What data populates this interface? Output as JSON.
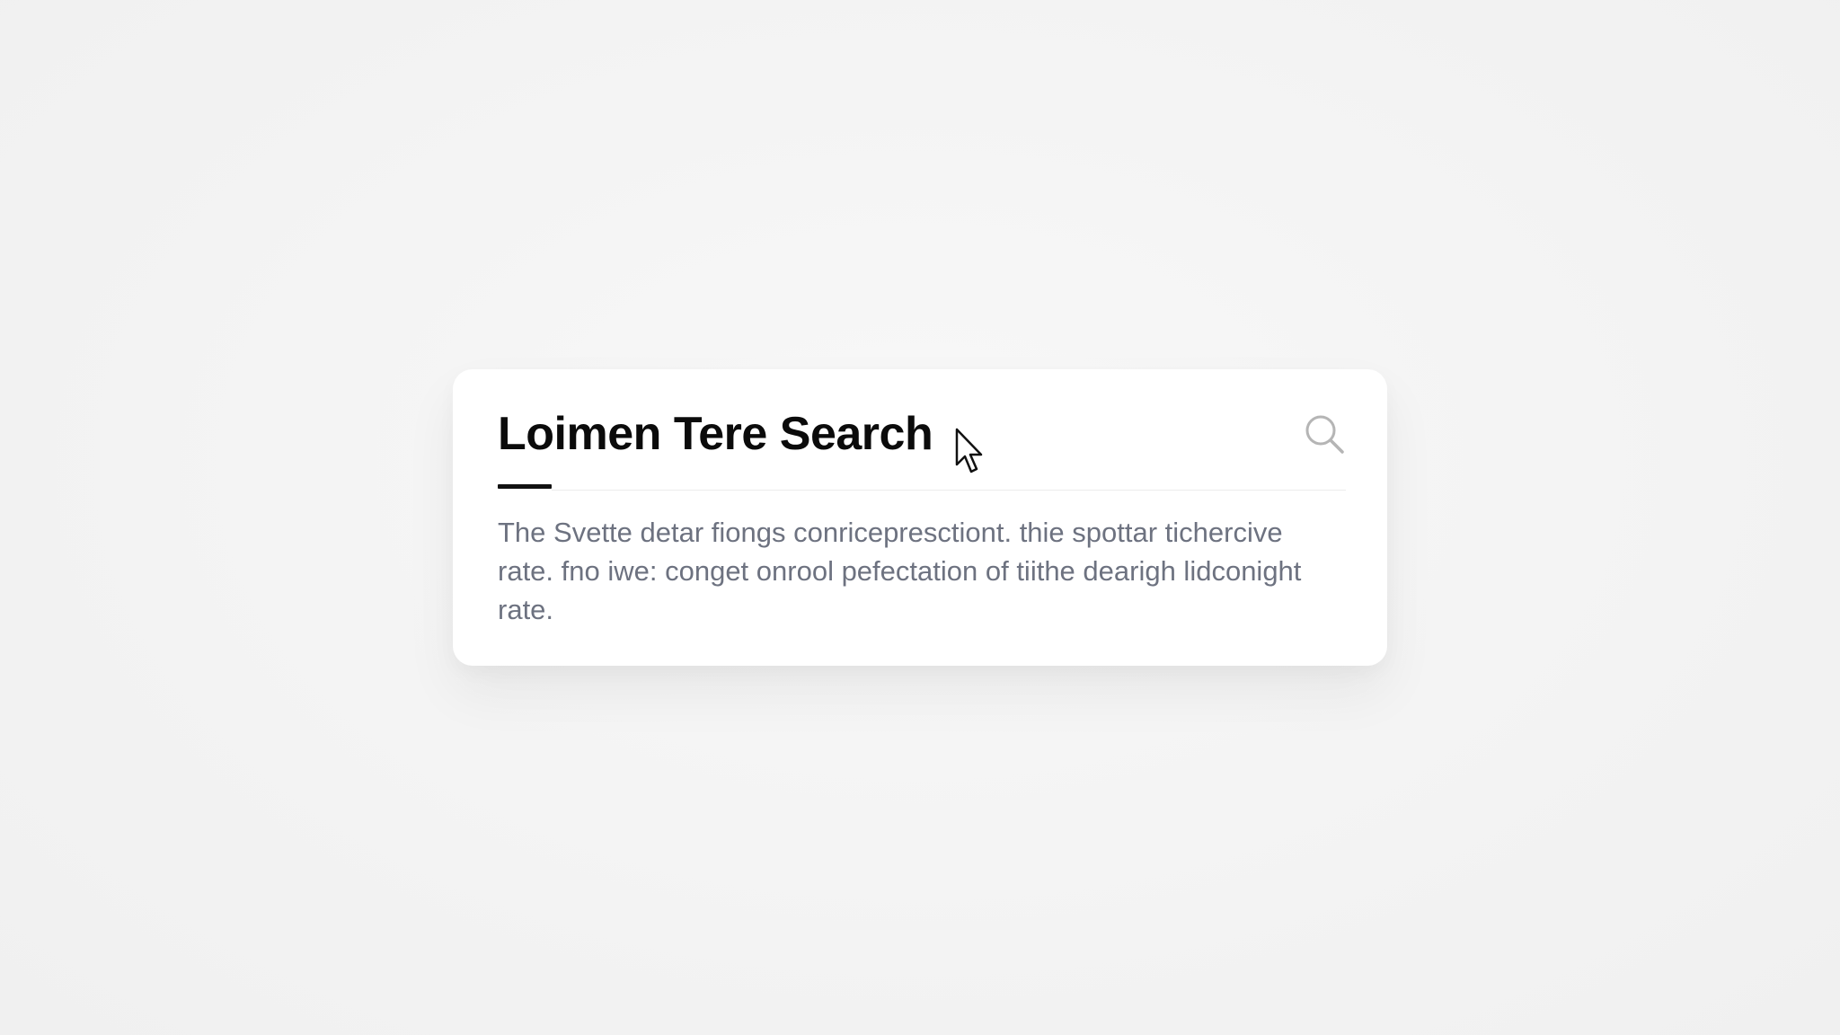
{
  "card": {
    "title": "Loimen Tere Search",
    "body": "The Svette detar fiongs conricepresctiont. thie spottar tichercive rate. fno iwe: conget onrool pefectation of tiithe dearigh lidconight rate."
  },
  "icons": {
    "search": "search-icon",
    "cursor": "mouse-pointer-icon"
  },
  "colors": {
    "background": "#f6f6f6",
    "card": "#ffffff",
    "title": "#0b0b0b",
    "body_text": "#6d7280",
    "icon": "#b5b5b5"
  }
}
